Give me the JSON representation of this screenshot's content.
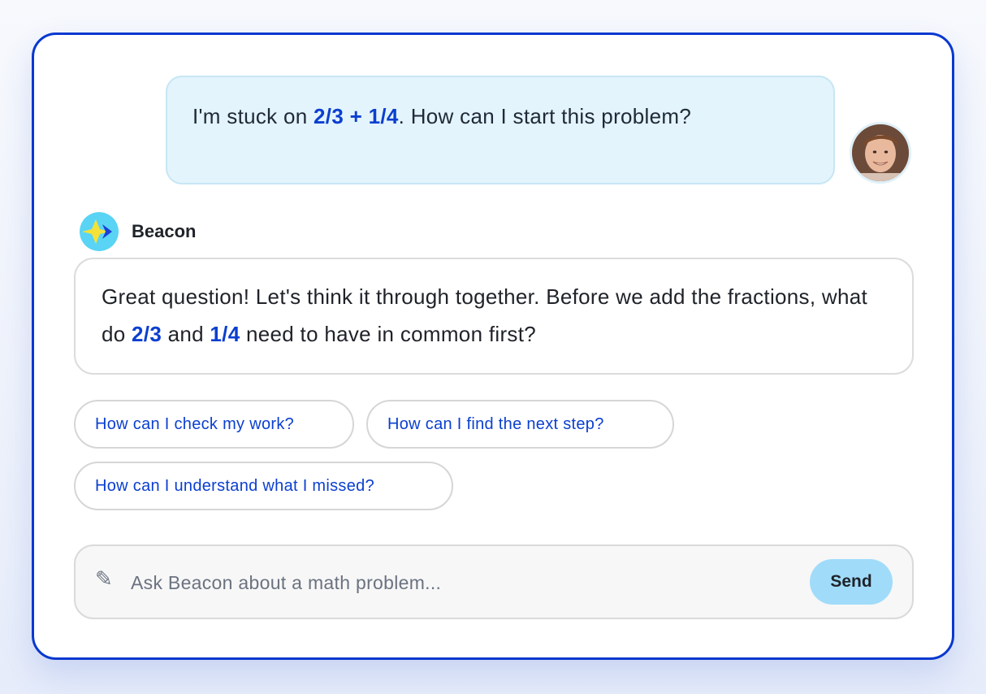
{
  "user_message": {
    "prefix": "I'm stuck on ",
    "math": "2/3 + 1/4",
    "suffix": ". How can I start this problem?"
  },
  "assistant": {
    "name": "Beacon",
    "message": {
      "part1": "Great question! Let's think it through together. Before we add the fractions, what do ",
      "math1": "2/3",
      "part2": " and ",
      "math2": "1/4",
      "part3": " need to have in common first?"
    }
  },
  "suggestions": [
    "How can I check my work?",
    "How can I find the next step?",
    "How can I understand what I missed?"
  ],
  "composer": {
    "placeholder": "Ask Beacon about a math problem...",
    "icon": "pencil-icon",
    "send_label": "Send"
  },
  "colors": {
    "frame_border": "#0838cf",
    "accent_text": "#0b3fd0",
    "user_bubble_bg": "#e3f4fc",
    "send_button_bg": "#a0dcfa",
    "bot_logo_bg": "#5ad4f4"
  }
}
